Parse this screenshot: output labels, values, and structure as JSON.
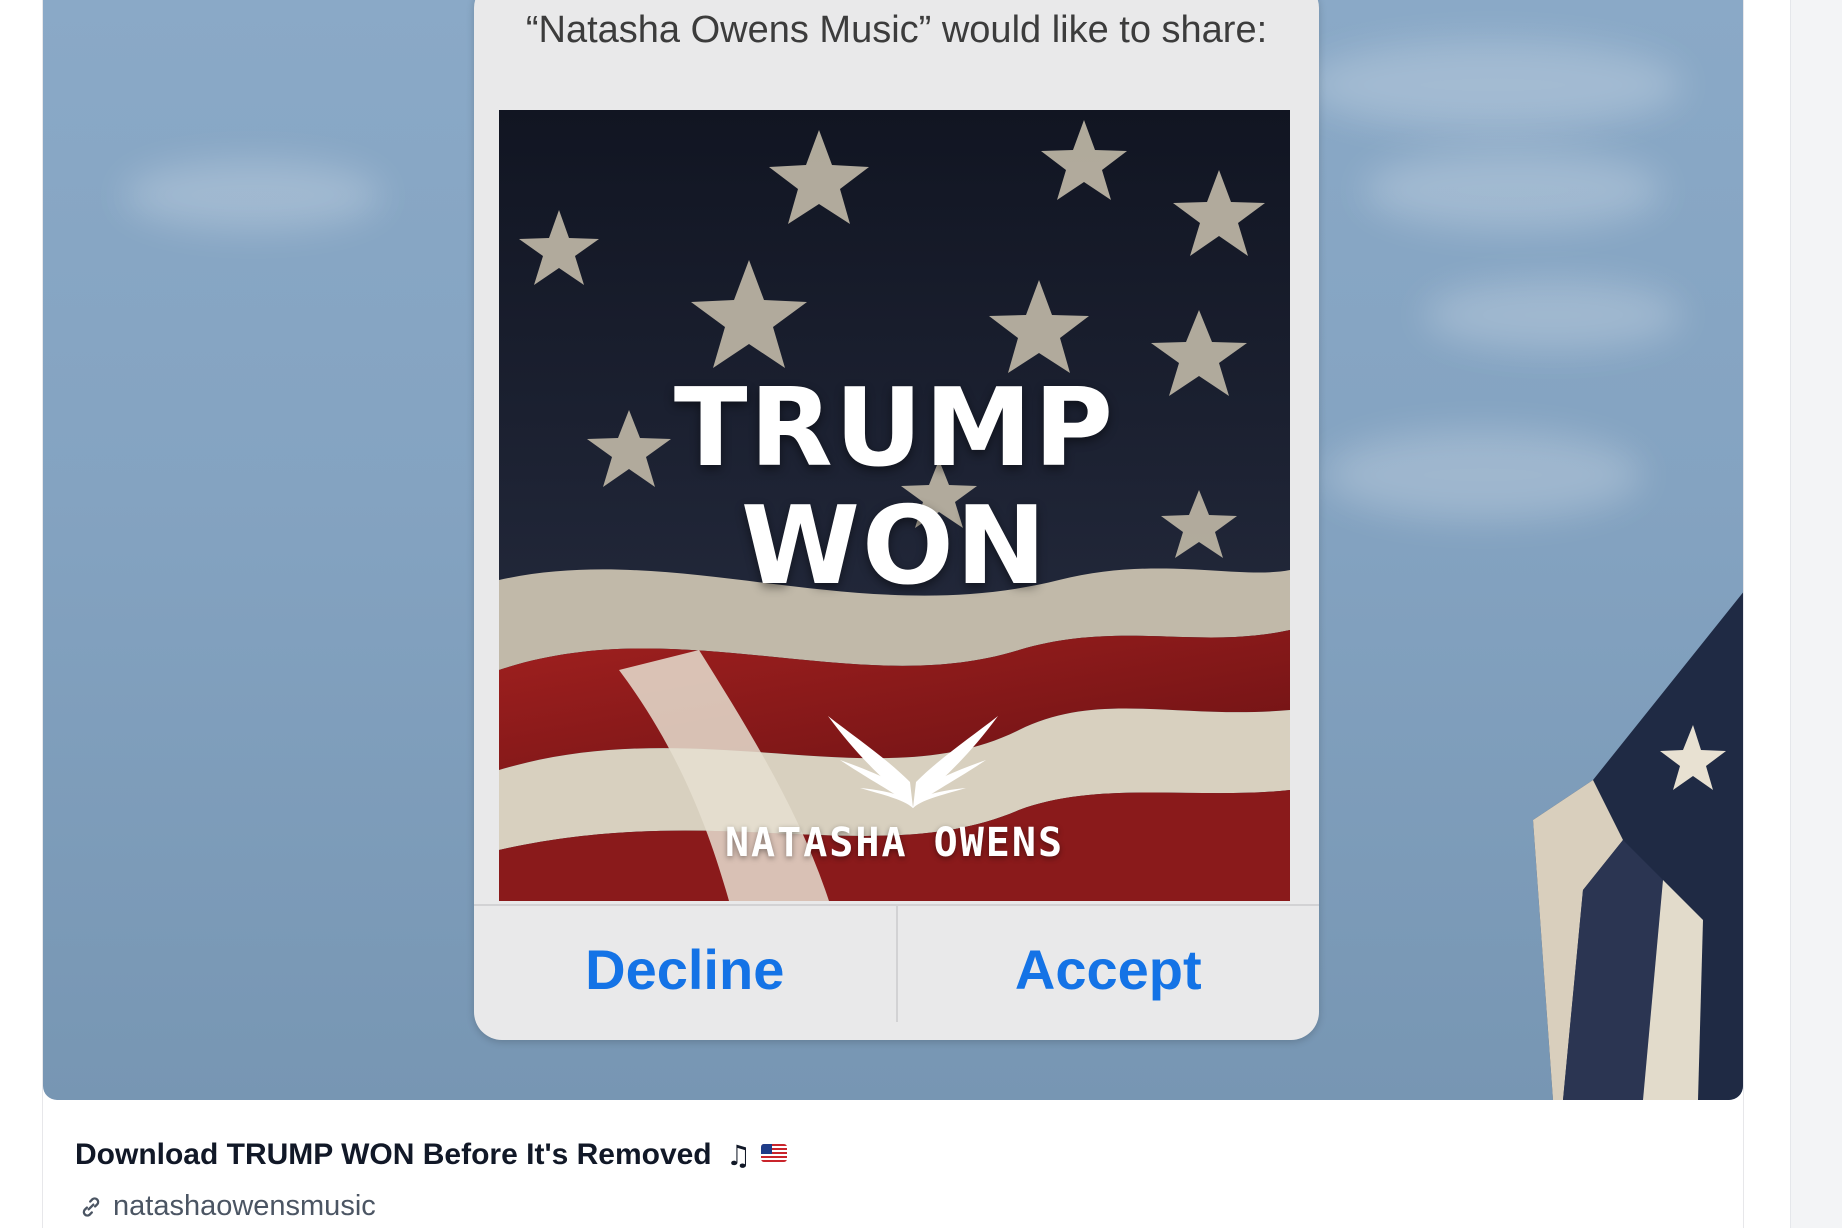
{
  "post": {
    "title": "Download TRUMP WON Before It's Removed",
    "title_emoji_note": "♫",
    "link_text": "natashaowensmusic"
  },
  "dialog": {
    "message": "“Natasha Owens Music” would like to share:",
    "decline_label": "Decline",
    "accept_label": "Accept",
    "button_color": "#1473e6"
  },
  "album": {
    "title_line1": "TRUMP",
    "title_line2": "WON",
    "artist": "NATASHA OWENS"
  },
  "icons": {
    "link": "link-icon",
    "music": "music-note-icon",
    "flag": "us-flag-icon",
    "wings": "wings-logo-icon"
  }
}
